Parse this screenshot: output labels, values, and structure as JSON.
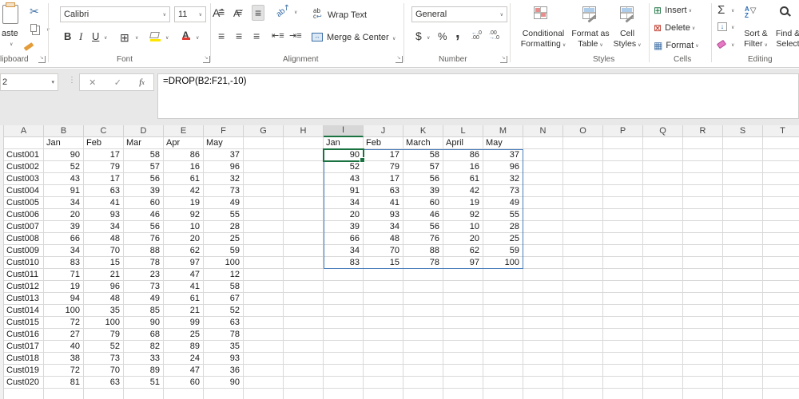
{
  "ribbon": {
    "paste_label": "aste",
    "font_name": "Calibri",
    "font_size": "11",
    "wrap_text": "Wrap Text",
    "merge_center": "Merge & Center",
    "number_format": "General",
    "styles_buttons": {
      "cf_l1": "Conditional",
      "cf_l2": "Formatting",
      "fat_l1": "Format as",
      "fat_l2": "Table",
      "cs_l1": "Cell",
      "cs_l2": "Styles"
    },
    "cells_buttons": {
      "insert": "Insert",
      "delete": "Delete",
      "format": "Format"
    },
    "editing_buttons": {
      "sf_l1": "Sort &",
      "sf_l2": "Filter",
      "fs_l1": "Find &",
      "fs_l2": "Select"
    },
    "groups": {
      "clipboard": "lipboard",
      "font": "Font",
      "alignment": "Alignment",
      "number": "Number",
      "styles": "Styles",
      "cells": "Cells",
      "editing": "Editing"
    }
  },
  "formula_bar": {
    "name_box": "2",
    "formula": "=DROP(B2:F21,-10)"
  },
  "colors": {
    "selection_green": "#1a7240",
    "spill_blue": "#4a7ebb"
  },
  "grid": {
    "col_headers": [
      "A",
      "B",
      "C",
      "D",
      "E",
      "F",
      "G",
      "H",
      "I",
      "J",
      "K",
      "L",
      "M",
      "N",
      "O",
      "P",
      "Q",
      "R",
      "S",
      "T"
    ],
    "selected_col": "I",
    "left_month_headers": [
      "Jan",
      "Feb",
      "Mar",
      "Apr",
      "May"
    ],
    "right_month_headers": [
      "Jan",
      "Feb",
      "March",
      "April",
      "May"
    ],
    "customers": [
      "Cust001",
      "Cust002",
      "Cust003",
      "Cust004",
      "Cust005",
      "Cust006",
      "Cust007",
      "Cust008",
      "Cust009",
      "Cust010",
      "Cust011",
      "Cust012",
      "Cust013",
      "Cust014",
      "Cust015",
      "Cust016",
      "Cust017",
      "Cust018",
      "Cust019",
      "Cust020"
    ],
    "values": [
      [
        90,
        17,
        58,
        86,
        37
      ],
      [
        52,
        79,
        57,
        16,
        96
      ],
      [
        43,
        17,
        56,
        61,
        32
      ],
      [
        91,
        63,
        39,
        42,
        73
      ],
      [
        34,
        41,
        60,
        19,
        49
      ],
      [
        20,
        93,
        46,
        92,
        55
      ],
      [
        39,
        34,
        56,
        10,
        28
      ],
      [
        66,
        48,
        76,
        20,
        25
      ],
      [
        34,
        70,
        88,
        62,
        59
      ],
      [
        83,
        15,
        78,
        97,
        100
      ],
      [
        71,
        21,
        23,
        47,
        12
      ],
      [
        19,
        96,
        73,
        41,
        58
      ],
      [
        94,
        48,
        49,
        61,
        67
      ],
      [
        100,
        35,
        85,
        21,
        52
      ],
      [
        72,
        100,
        90,
        99,
        63
      ],
      [
        27,
        79,
        68,
        25,
        78
      ],
      [
        40,
        52,
        82,
        89,
        35
      ],
      [
        38,
        73,
        33,
        24,
        93
      ],
      [
        72,
        70,
        89,
        47,
        36
      ],
      [
        81,
        63,
        51,
        60,
        90
      ]
    ],
    "spill_row_count": 10
  }
}
